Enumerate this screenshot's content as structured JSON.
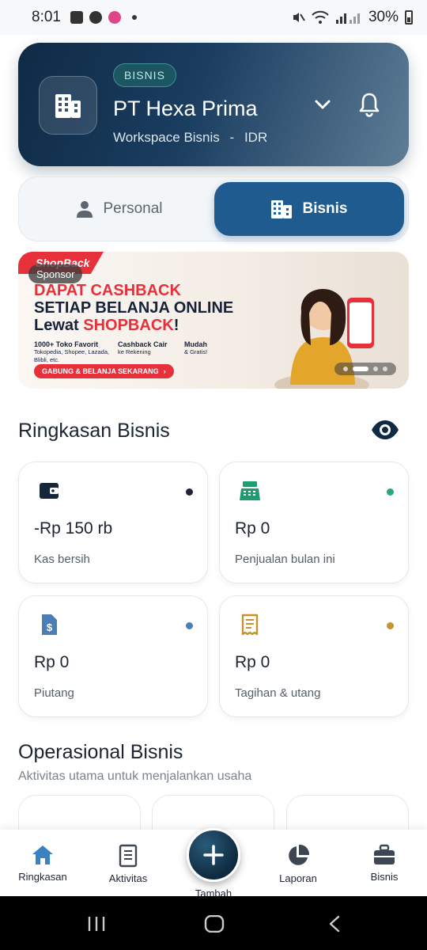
{
  "status_bar": {
    "time": "8:01",
    "battery": "30%"
  },
  "header": {
    "badge": "BISNIS",
    "company": "PT Hexa Prima",
    "workspace": "Workspace Bisnis",
    "separator": "-",
    "currency": "IDR"
  },
  "toggle": {
    "personal": "Personal",
    "bisnis": "Bisnis",
    "active": "bisnis"
  },
  "banner": {
    "brand": "ShopBack",
    "sponsor": "Sponsor",
    "line1": "DAPAT CASHBACK",
    "line2": "SETIAP BELANJA ONLINE",
    "line3_prefix": "Lewat",
    "line3_brand": "SHOPBACK",
    "line3_suffix": "!",
    "features": [
      {
        "title": "1000+ Toko Favorit",
        "sub": "Tokopedia, Shopee, Lazada, Blibli, etc."
      },
      {
        "title": "Cashback Cair",
        "sub": "ke Rekening"
      },
      {
        "title": "Mudah",
        "sub": "& Gratis!"
      }
    ],
    "cta": "GABUNG & BELANJA SEKARANG",
    "slides_total": 4,
    "slide_active": 2
  },
  "summary": {
    "title": "Ringkasan Bisnis",
    "cards": [
      {
        "value": "-Rp 150 rb",
        "label": "Kas bersih",
        "icon": "wallet-icon",
        "dot_color": "#1a2433"
      },
      {
        "value": "Rp 0",
        "label": "Penjualan bulan ini",
        "icon": "cash-register-icon",
        "dot_color": "#2aa876"
      },
      {
        "value": "Rp 0",
        "label": "Piutang",
        "icon": "invoice-dollar-icon",
        "dot_color": "#4a7fb5"
      },
      {
        "value": "Rp 0",
        "label": "Tagihan & utang",
        "icon": "receipt-icon",
        "dot_color": "#c8922e"
      }
    ]
  },
  "operations": {
    "title": "Operasional Bisnis",
    "subtitle": "Aktivitas utama untuk menjalankan usaha"
  },
  "bottom_nav": {
    "items": [
      {
        "label": "Ringkasan",
        "icon": "home-icon",
        "active": true
      },
      {
        "label": "Aktivitas",
        "icon": "document-list-icon"
      },
      {
        "label": "Tambah",
        "icon": "plus-icon"
      },
      {
        "label": "Laporan",
        "icon": "pie-chart-icon"
      },
      {
        "label": "Bisnis",
        "icon": "briefcase-icon"
      }
    ]
  },
  "colors": {
    "header_dark": "#0f2a45",
    "primary": "#1f5b8f",
    "active_nav": "#3b82c4",
    "brand_red": "#e8303a"
  }
}
